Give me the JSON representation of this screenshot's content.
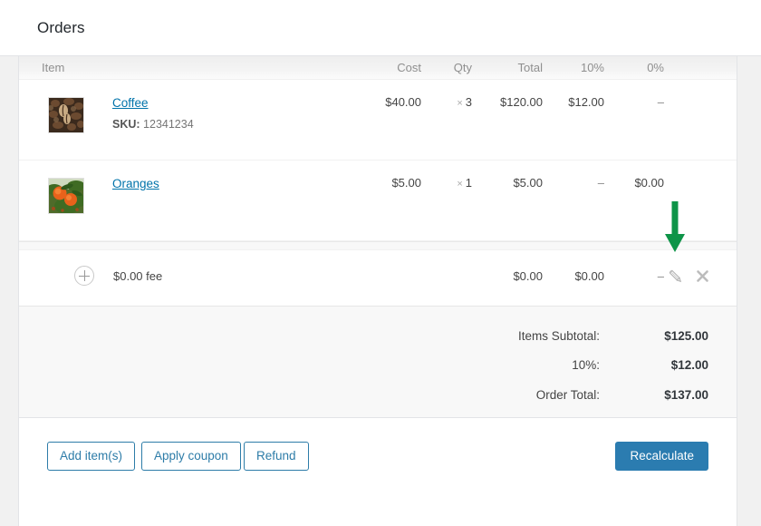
{
  "header": {
    "title": "Orders"
  },
  "items_table": {
    "columns": [
      {
        "key": "item",
        "label": "Item"
      },
      {
        "key": "cost",
        "label": "Cost"
      },
      {
        "key": "qty",
        "label": "Qty"
      },
      {
        "key": "total",
        "label": "Total"
      },
      {
        "key": "tax10",
        "label": "10%"
      },
      {
        "key": "tax0",
        "label": "0%"
      }
    ],
    "rows": [
      {
        "name": "Coffee",
        "thumbnail": "coffee-beans-thumbnail",
        "meta_label": "SKU:",
        "meta_value": "12341234",
        "cost": "$40.00",
        "qty_symbol": "×",
        "qty": "3",
        "total": "$120.00",
        "tax10": "$12.00",
        "tax0": "–"
      },
      {
        "name": "Oranges",
        "thumbnail": "oranges-thumbnail",
        "meta_label": "",
        "meta_value": "",
        "cost": "$5.00",
        "qty_symbol": "×",
        "qty": "1",
        "total": "$5.00",
        "tax10": "–",
        "tax0": "$0.00"
      }
    ],
    "fee_row": {
      "add_icon": "circle-plus-icon",
      "label": "$0.00 fee",
      "total": "$0.00",
      "tax10": "$0.00",
      "tax0": "–",
      "edit_icon": "pencil-icon",
      "delete_icon": "close-x-icon"
    }
  },
  "totals": [
    {
      "label": "Items Subtotal:",
      "value": "$125.00"
    },
    {
      "label": "10%:",
      "value": "$12.00"
    },
    {
      "label": "Order Total:",
      "value": "$137.00"
    }
  ],
  "footer": {
    "add_items_label": "Add item(s)",
    "apply_coupon_label": "Apply coupon",
    "refund_label": "Refund",
    "recalculate_label": "Recalculate"
  },
  "annotation": {
    "type": "down-arrow",
    "color": "#0e9448",
    "points_to": "pencil-icon"
  },
  "colors": {
    "link": "#0073aa",
    "primary_button": "#2b7cb0",
    "secondary_button_border": "#2d7ca8",
    "panel_background": "#ffffff",
    "totals_background": "#f8f8f8",
    "page_background": "#f1f1f1",
    "annotation_green": "#0e9448"
  }
}
